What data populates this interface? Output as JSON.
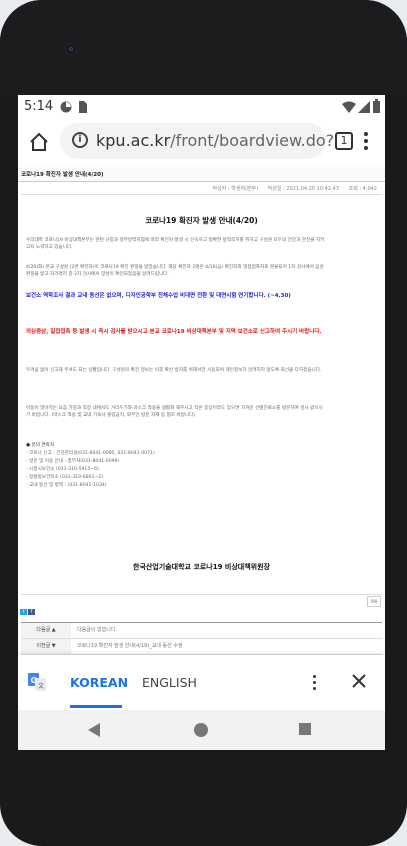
{
  "status_bar": {
    "time": "5:14"
  },
  "url_bar": {
    "url_host": "kpu.ac.kr",
    "url_path": "/front/boardview.do?",
    "tab_count": "1"
  },
  "page": {
    "page_title": "코로나19 확진자 발생 안내(4/20)",
    "meta": {
      "author": "작성자 : 학생처(본부)",
      "date": "작성일 : 2021.04.20 10:42:47",
      "views": "조회 : 4,042"
    },
    "article_title": "코로나19 확진자 발생 안내(4/20)",
    "para1": "우리대학 코로나19 비상대책본부는 관련 규정과 정부방역지침에 따라 확진자 발생 시 신속하고 정확한 방역조치를 취하고 구성원 모두의 건강과 안전을 지키고자 노력하고 있습니다.",
    "para2": "4/20(화) 본교 구성원 (2번 확진자)이 코로나19 확진 판정을 받았습니다. 해당 확진자 2명은 4/16(금) 확진자와 밀접접촉자로 분류되어 1차 검사에서 음성 판정을 받고 자가격리 중 2차 검사에서 양성이 확인되었음을 알려드립니다.",
    "blue_notice": "보건소 역학조사 결과 교내 동선은 없으며, 디자인공학부 전체수업 비대면 전환 및 대면시험 연기합니다. (~4.30)",
    "red_notice": "의심증상, 밀접접촉 등 발생 시 즉시 검사를 받으시고 본교 코로나19 비상대책본부 및 지역 보건소로 신고하여 주시기 바랍니다.",
    "para3": "두려움 없이 신고해 주셔도 되는 상황입니다. 구성원의 확진 정보는 이후 확산 방지를 위해서만 사용되며 개인정보가 알려지지 않도록 최선을 다하겠습니다.",
    "para4": "이동이 많아지는 요즘 가정과 직장 내에서도 거리두기와 마스크 착용을 생활화 해주시고 작은 증상이라도 있으면 가까운 선별진료소를 방문하여 검사 받으시기 바랍니다. (마스크 착용 및 교내 기숙사 출입금지, 외부인 방문 자제 등 협조 바랍니다)",
    "contact_title": "● 문의 연락처",
    "contacts": [
      "- 코로나 신고 : 건강관리실(031-8041-0085, 031-8041-0071)",
      "- 방문 및 이용 안내 : 총무처(031-8041-0099)",
      "- 시흥시보건소 (031-310-5915~6)",
      "- 정왕동보건지소 (031-310-6801~2)",
      "- 교내 동선 및 방역 : (031-8041-1034)"
    ],
    "signature": "한국산업기술대학교 코로나19 비상대책위원장",
    "share": {
      "twitter": "t",
      "facebook": "f"
    },
    "list_button": "목록",
    "nav": [
      {
        "label": "다음글 ▲",
        "value": "다음글이 없습니다."
      },
      {
        "label": "이전글 ▼",
        "value": "코로나19 확진자 발생 안내(4/19)_교내 동선 수정"
      }
    ]
  },
  "translate_bar": {
    "lang_source": "KOREAN",
    "lang_target": "ENGLISH"
  },
  "colors": {
    "link_blue": "#1a73e8",
    "notice_blue": "#1a24d8",
    "notice_red": "#e01818"
  }
}
